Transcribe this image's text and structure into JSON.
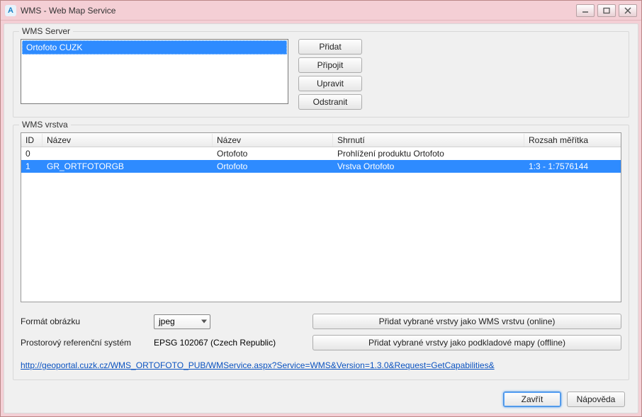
{
  "window": {
    "title": "WMS - Web Map Service"
  },
  "server_group": {
    "title": "WMS Server",
    "items": [
      "Ortofoto CUZK"
    ],
    "buttons": {
      "add": "Přidat",
      "connect": "Připojit",
      "edit": "Upravit",
      "remove": "Odstranit"
    }
  },
  "layer_group": {
    "title": "WMS vrstva",
    "columns": {
      "id": "ID",
      "name1": "Název",
      "name2": "Název",
      "summary": "Shrnutí",
      "scale": "Rozsah měřítka"
    },
    "rows": [
      {
        "id": "0",
        "name1": "",
        "name2": "Ortofoto",
        "summary": "Prohlížení produktu Ortofoto",
        "scale": "",
        "selected": false
      },
      {
        "id": "1",
        "name1": "GR_ORTFOTORGB",
        "name2": "Ortofoto",
        "summary": "Vrstva Ortofoto",
        "scale": "1:3 - 1:7576144",
        "selected": true
      }
    ],
    "format_label": "Formát obrázku",
    "format_value": "jpeg",
    "srs_label": "Prostorový referenční systém",
    "srs_value": "EPSG 102067 (Czech Republic)",
    "buttons": {
      "add_online": "Přidat vybrané vrstvy jako WMS vrstvu (online)",
      "add_offline": "Přidat vybrané vrstvy jako podkladové mapy (offline)"
    },
    "url": "http://geoportal.cuzk.cz/WMS_ORTOFOTO_PUB/WMService.aspx?Service=WMS&Version=1.3.0&Request=GetCapabilities&"
  },
  "footer": {
    "close": "Zavřít",
    "help": "Nápověda"
  }
}
